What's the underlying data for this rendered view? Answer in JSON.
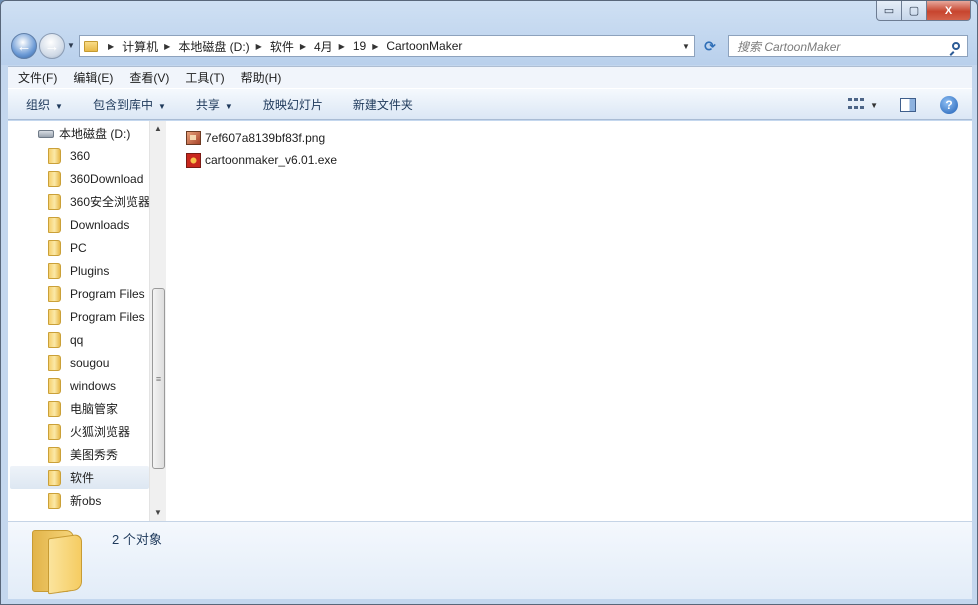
{
  "window": {
    "controls": {
      "minimize": "▭",
      "maximize": "▢",
      "close": "X"
    }
  },
  "address": {
    "crumbs": [
      "计算机",
      "本地磁盘 (D:)",
      "软件",
      "4月",
      "19",
      "CartoonMaker"
    ]
  },
  "search": {
    "placeholder": "搜索 CartoonMaker"
  },
  "menu": [
    "文件(F)",
    "编辑(E)",
    "查看(V)",
    "工具(T)",
    "帮助(H)"
  ],
  "toolbar": {
    "organize": "组织",
    "include_library": "包含到库中",
    "share": "共享",
    "slideshow": "放映幻灯片",
    "new_folder": "新建文件夹"
  },
  "nav": {
    "root": "本地磁盘 (D:)",
    "items": [
      "360",
      "360Download",
      "360安全浏览器",
      "Downloads",
      "PC",
      "Plugins",
      "Program Files",
      "Program Files",
      "qq",
      "sougou",
      "windows",
      "电脑管家",
      "火狐浏览器",
      "美图秀秀",
      "软件",
      "新obs"
    ],
    "selected": "软件"
  },
  "files": [
    {
      "name": "7ef607a8139bf83f.png",
      "icon": "png-file-icon"
    },
    {
      "name": "cartoonmaker_v6.01.exe",
      "icon": "exe-file-icon"
    }
  ],
  "details": {
    "count": "2 个对象"
  }
}
